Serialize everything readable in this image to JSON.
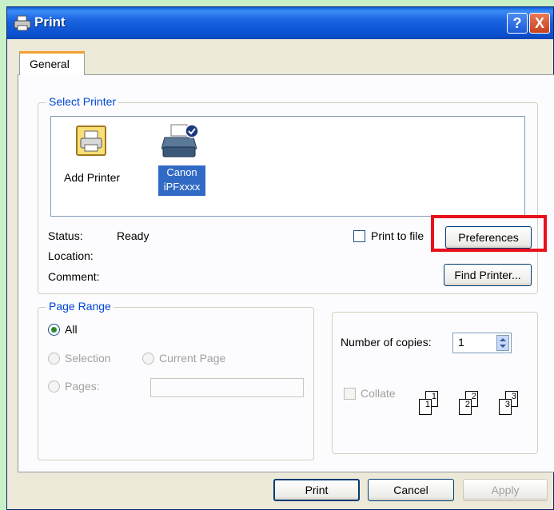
{
  "window": {
    "title": "Print",
    "help_symbol": "?",
    "close_symbol": "X",
    "tab_general": "General"
  },
  "select_printer": {
    "legend": "Select Printer",
    "printers": [
      {
        "name": "Add Printer",
        "selected": false,
        "icon": "add-printer-icon"
      },
      {
        "name_line1": "Canon",
        "name_line2": "iPFxxxx",
        "selected": true,
        "icon": "printer-icon"
      }
    ],
    "status_label": "Status:",
    "status_value": "Ready",
    "location_label": "Location:",
    "comment_label": "Comment:",
    "print_to_file_label": "Print to file",
    "preferences_button": "Preferences",
    "find_printer_button": "Find Printer..."
  },
  "page_range": {
    "legend": "Page Range",
    "all_label": "All",
    "selection_label": "Selection",
    "current_page_label": "Current Page",
    "pages_label": "Pages:",
    "pages_value": ""
  },
  "copies": {
    "number_label": "Number of copies:",
    "number_value": "1",
    "collate_label": "Collate",
    "page_numbers": [
      "1",
      "1",
      "2",
      "2",
      "3",
      "3"
    ]
  },
  "footer": {
    "print_button": "Print",
    "cancel_button": "Cancel",
    "apply_button": "Apply"
  },
  "colors": {
    "highlight": "#e8101c",
    "legend_text": "#0046d5",
    "selection": "#316ac5"
  }
}
